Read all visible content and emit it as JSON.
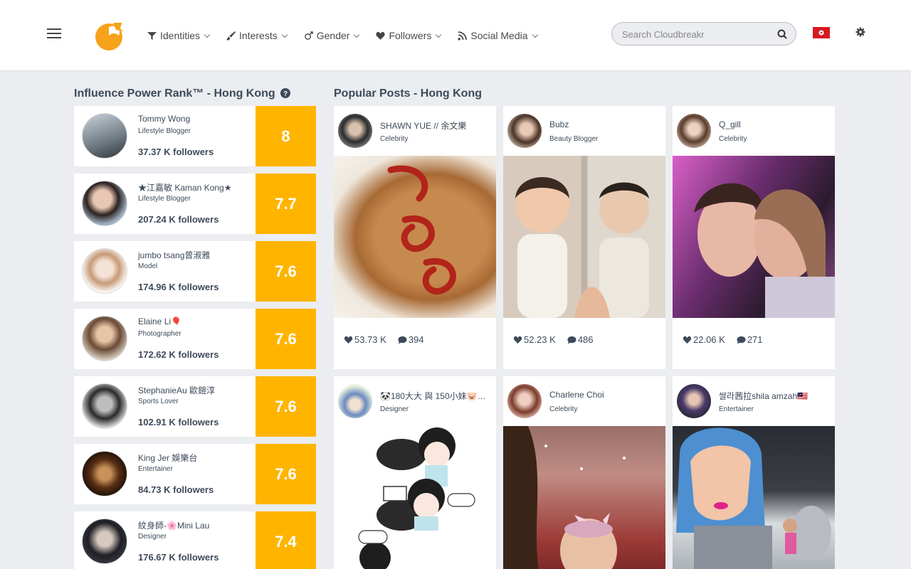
{
  "nav": {
    "items": [
      {
        "label": "Identities",
        "icon": "filter-icon"
      },
      {
        "label": "Interests",
        "icon": "brush-icon"
      },
      {
        "label": "Gender",
        "icon": "gender-icon"
      },
      {
        "label": "Followers",
        "icon": "heart-icon"
      },
      {
        "label": "Social Media",
        "icon": "rss-icon"
      }
    ]
  },
  "search": {
    "placeholder": "Search Cloudbreakr"
  },
  "colors": {
    "accent": "#ffb400",
    "logo": "#f7a21b",
    "title": "#3d4a5a",
    "flag": "#d71920"
  },
  "rank": {
    "title": "Influence Power Rank™ - Hong Kong",
    "items": [
      {
        "name": "Tommy Wong",
        "category": "Lifestyle Blogger",
        "followers": "37.37 K followers",
        "score": "8"
      },
      {
        "name": "★江嘉敏 Kaman Kong★",
        "category": "Lifestyle Blogger",
        "followers": "207.24 K followers",
        "score": "7.7"
      },
      {
        "name": "jumbo tsang曾淑雅",
        "category": "Model",
        "followers": "174.96 K followers",
        "score": "7.6"
      },
      {
        "name": "Elaine Li🎈",
        "category": "Photographer",
        "followers": "172.62 K followers",
        "score": "7.6"
      },
      {
        "name": "StephanieAu 歐鎧淳",
        "category": "Sports Lover",
        "followers": "102.91 K followers",
        "score": "7.6"
      },
      {
        "name": "King Jer 娛樂台",
        "category": "Entertainer",
        "followers": "84.73 K followers",
        "score": "7.6"
      },
      {
        "name": "紋身師-🌸Mini Lau",
        "category": "Designer",
        "followers": "176.67 K followers",
        "score": "7.4"
      }
    ]
  },
  "posts": {
    "title": "Popular Posts - Hong Kong",
    "items": [
      {
        "name": "SHAWN YUE // 余文樂",
        "category": "Celebrity",
        "likes": "53.73 K",
        "comments": "394"
      },
      {
        "name": "Bubz",
        "category": "Beauty Blogger",
        "likes": "52.23 K",
        "comments": "486"
      },
      {
        "name": "Q_gill",
        "category": "Celebrity",
        "likes": "22.06 K",
        "comments": "271"
      },
      {
        "name": "🐼180大大 與 150小妹🐷香...",
        "category": "Designer"
      },
      {
        "name": "Charlene Choi",
        "category": "Celebrity"
      },
      {
        "name": "쌀라茜拉shila amzah🇲🇾",
        "category": "Entertainer"
      }
    ]
  }
}
